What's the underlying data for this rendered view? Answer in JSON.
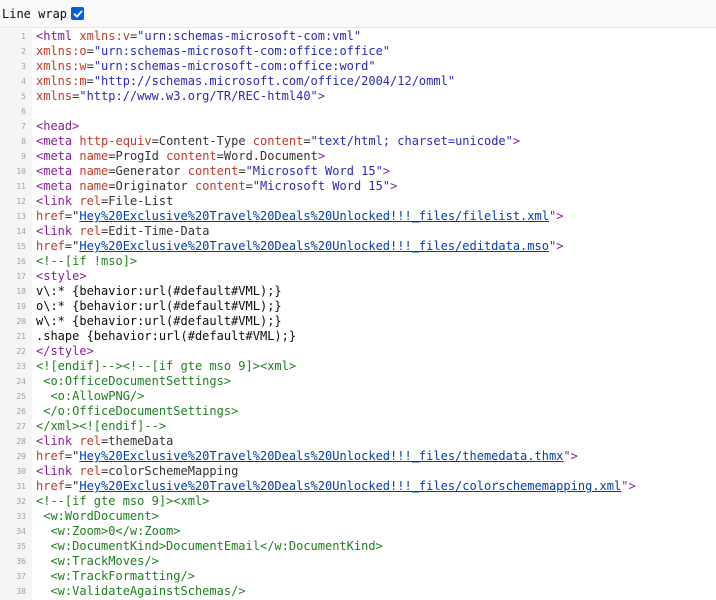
{
  "toolbar": {
    "line_wrap_label": "Line wrap",
    "line_wrap_checked": true
  },
  "colors": {
    "tag": "#8a1c9c",
    "attr": "#c03a29",
    "string": "#2a2ab5",
    "link": "#003eaa",
    "comment": "#208020",
    "checkbox": "#0060df"
  },
  "lines": [
    {
      "n": "1",
      "c": "tag",
      "t": "<html "
    },
    {
      "n": "2",
      "c": "",
      "t": ""
    },
    {
      "n": "3",
      "c": "",
      "t": ""
    },
    {
      "n": "4",
      "c": "",
      "t": ""
    },
    {
      "n": "5",
      "c": "",
      "t": ""
    },
    {
      "n": "6",
      "c": "",
      "t": ""
    },
    {
      "n": "7",
      "c": "tag",
      "t": "<head>"
    },
    {
      "n": "8",
      "c": "",
      "t": ""
    },
    {
      "n": "9",
      "c": "",
      "t": ""
    },
    {
      "n": "10",
      "c": "",
      "t": ""
    },
    {
      "n": "11",
      "c": "",
      "t": ""
    },
    {
      "n": "12",
      "c": "",
      "t": ""
    },
    {
      "n": "13",
      "c": "",
      "t": ""
    },
    {
      "n": "14",
      "c": "",
      "t": ""
    },
    {
      "n": "15",
      "c": "",
      "t": ""
    },
    {
      "n": "16",
      "c": "cmt",
      "t": "<!--[if !mso]>"
    },
    {
      "n": "17",
      "c": "tag",
      "t": "<style>"
    },
    {
      "n": "18",
      "c": "",
      "t": "v\\:* {behavior:url(#default#VML);}"
    },
    {
      "n": "19",
      "c": "",
      "t": "o\\:* {behavior:url(#default#VML);}"
    },
    {
      "n": "20",
      "c": "",
      "t": "w\\:* {behavior:url(#default#VML);}"
    },
    {
      "n": "21",
      "c": "",
      "t": ".shape {behavior:url(#default#VML);}"
    },
    {
      "n": "22",
      "c": "tag",
      "t": "</style>"
    },
    {
      "n": "23",
      "c": "cmt",
      "t": "<![endif]--><!--[if gte mso 9]><xml>"
    },
    {
      "n": "24",
      "c": "",
      "t": " <o:OfficeDocumentSettings>"
    },
    {
      "n": "25",
      "c": "",
      "t": "  <o:AllowPNG/>"
    },
    {
      "n": "26",
      "c": "",
      "t": " </o:OfficeDocumentSettings>"
    },
    {
      "n": "27",
      "c": "",
      "t": "</xml><![endif]-->"
    },
    {
      "n": "28",
      "c": "",
      "t": ""
    },
    {
      "n": "29",
      "c": "",
      "t": ""
    },
    {
      "n": "30",
      "c": "",
      "t": ""
    },
    {
      "n": "31",
      "c": "",
      "t": ""
    },
    {
      "n": "32",
      "c": "cmt",
      "t": "<!--[if gte mso 9]><xml>"
    },
    {
      "n": "33",
      "c": "",
      "t": " <w:WordDocument>"
    },
    {
      "n": "34",
      "c": "",
      "t": "  <w:Zoom>0</w:Zoom>"
    },
    {
      "n": "35",
      "c": "",
      "t": "  <w:DocumentKind>DocumentEmail</w:DocumentKind>"
    },
    {
      "n": "36",
      "c": "",
      "t": "  <w:TrackMoves/>"
    },
    {
      "n": "37",
      "c": "",
      "t": "  <w:TrackFormatting/>"
    },
    {
      "n": "38",
      "c": "",
      "t": "  <w:ValidateAgainstSchemas/>"
    }
  ],
  "rich": {
    "l1": [
      "<html ",
      "xmlns:v",
      "=",
      "\"urn:schemas-microsoft-com:vml\""
    ],
    "l2": [
      "xmlns:o",
      "=",
      "\"urn:schemas-microsoft-com:office:office\""
    ],
    "l3": [
      "xmlns:w",
      "=",
      "\"urn:schemas-microsoft-com:office:word\""
    ],
    "l4": [
      "xmlns:m",
      "=",
      "\"http://schemas.microsoft.com/office/2004/12/omml\""
    ],
    "l5": [
      "xmlns",
      "=",
      "\"http://www.w3.org/TR/REC-html40\"",
      ">"
    ],
    "l8": [
      "<meta ",
      "http-equiv",
      "=",
      "Content-Type ",
      "content",
      "=",
      "\"text/html; charset=unicode\"",
      ">"
    ],
    "l9": [
      "<meta ",
      "name",
      "=",
      "ProgId ",
      "content",
      "=",
      "Word.Document",
      ">"
    ],
    "l10": [
      "<meta ",
      "name",
      "=",
      "Generator ",
      "content",
      "=",
      "\"Microsoft Word 15\"",
      ">"
    ],
    "l11": [
      "<meta ",
      "name",
      "=",
      "Originator ",
      "content",
      "=",
      "\"Microsoft Word 15\"",
      ">"
    ],
    "l12": [
      "<link ",
      "rel",
      "=",
      "File-List"
    ],
    "l13": [
      "href",
      "=\"",
      "Hey%20Exclusive%20Travel%20Deals%20Unlocked!!!_files/filelist.xml",
      "\">"
    ],
    "l14": [
      "<link ",
      "rel",
      "=",
      "Edit-Time-Data"
    ],
    "l15": [
      "href",
      "=\"",
      "Hey%20Exclusive%20Travel%20Deals%20Unlocked!!!_files/editdata.mso",
      "\">"
    ],
    "l28": [
      "<link ",
      "rel",
      "=",
      "themeData"
    ],
    "l29": [
      "href",
      "=\"",
      "Hey%20Exclusive%20Travel%20Deals%20Unlocked!!!_files/themedata.thmx",
      "\">"
    ],
    "l30": [
      "<link ",
      "rel",
      "=",
      "colorSchemeMapping"
    ],
    "l31": [
      "href",
      "=\"",
      "Hey%20Exclusive%20Travel%20Deals%20Unlocked!!!_files/colorschememapping.xml",
      "\">"
    ]
  }
}
